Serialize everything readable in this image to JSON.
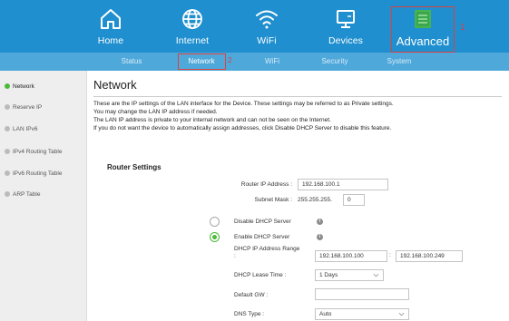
{
  "nav": {
    "tabs": [
      {
        "label": "Home",
        "icon": "home-icon"
      },
      {
        "label": "Internet",
        "icon": "globe-icon"
      },
      {
        "label": "WiFi",
        "icon": "wifi-icon"
      },
      {
        "label": "Devices",
        "icon": "monitor-icon"
      },
      {
        "label": "Advanced",
        "icon": "advanced-settings-icon"
      }
    ],
    "active_tab": "Advanced",
    "callout": "1",
    "highlight_color": "#d9433f",
    "bar_color": "#1f8fcf"
  },
  "subnav": {
    "items": [
      "Status",
      "Network",
      "WiFi",
      "Security",
      "System"
    ],
    "active": "Network",
    "callout": "2",
    "bar_color": "#4fa8da"
  },
  "sidebar": {
    "items": [
      "Network",
      "Reserve IP",
      "LAN IPv6",
      "IPv4 Routing Table",
      "IPv6 Routing Table",
      "ARP Table"
    ],
    "active": "Network",
    "active_color": "#4dbb3a"
  },
  "page": {
    "title": "Network",
    "description": [
      "These are the IP settings of the LAN interface for the Device. These settings may be referred to as Private settings.",
      "You may change the LAN IP address if needed.",
      "The LAN IP address is private to your internal network and can not be seen on the Internet.",
      "If you do not want the device to automatically assign addresses, click Disable DHCP Server to disable this feature."
    ]
  },
  "router_settings": {
    "title": "Router Settings",
    "ip_label": "Router IP Address :",
    "ip_value": "192.168.100.1",
    "mask_label": "Subnet Mask :",
    "mask_prefix": "255.255.255.",
    "mask_last": "0",
    "dhcp_disable_label": "Disable DHCP Server",
    "dhcp_enable_label": "Enable DHCP Server",
    "dhcp_selected": "Enable DHCP Server",
    "range_label": "DHCP IP Address Range :",
    "range_start": "192.168.100.100",
    "range_sep": ":",
    "range_end": "192.168.100.249",
    "lease_label": "DHCP Lease Time :",
    "lease_value": "1 Days",
    "gw_label": "Default GW :",
    "gw_value": "",
    "dns_label": "DNS Type :",
    "dns_value": "Auto"
  }
}
